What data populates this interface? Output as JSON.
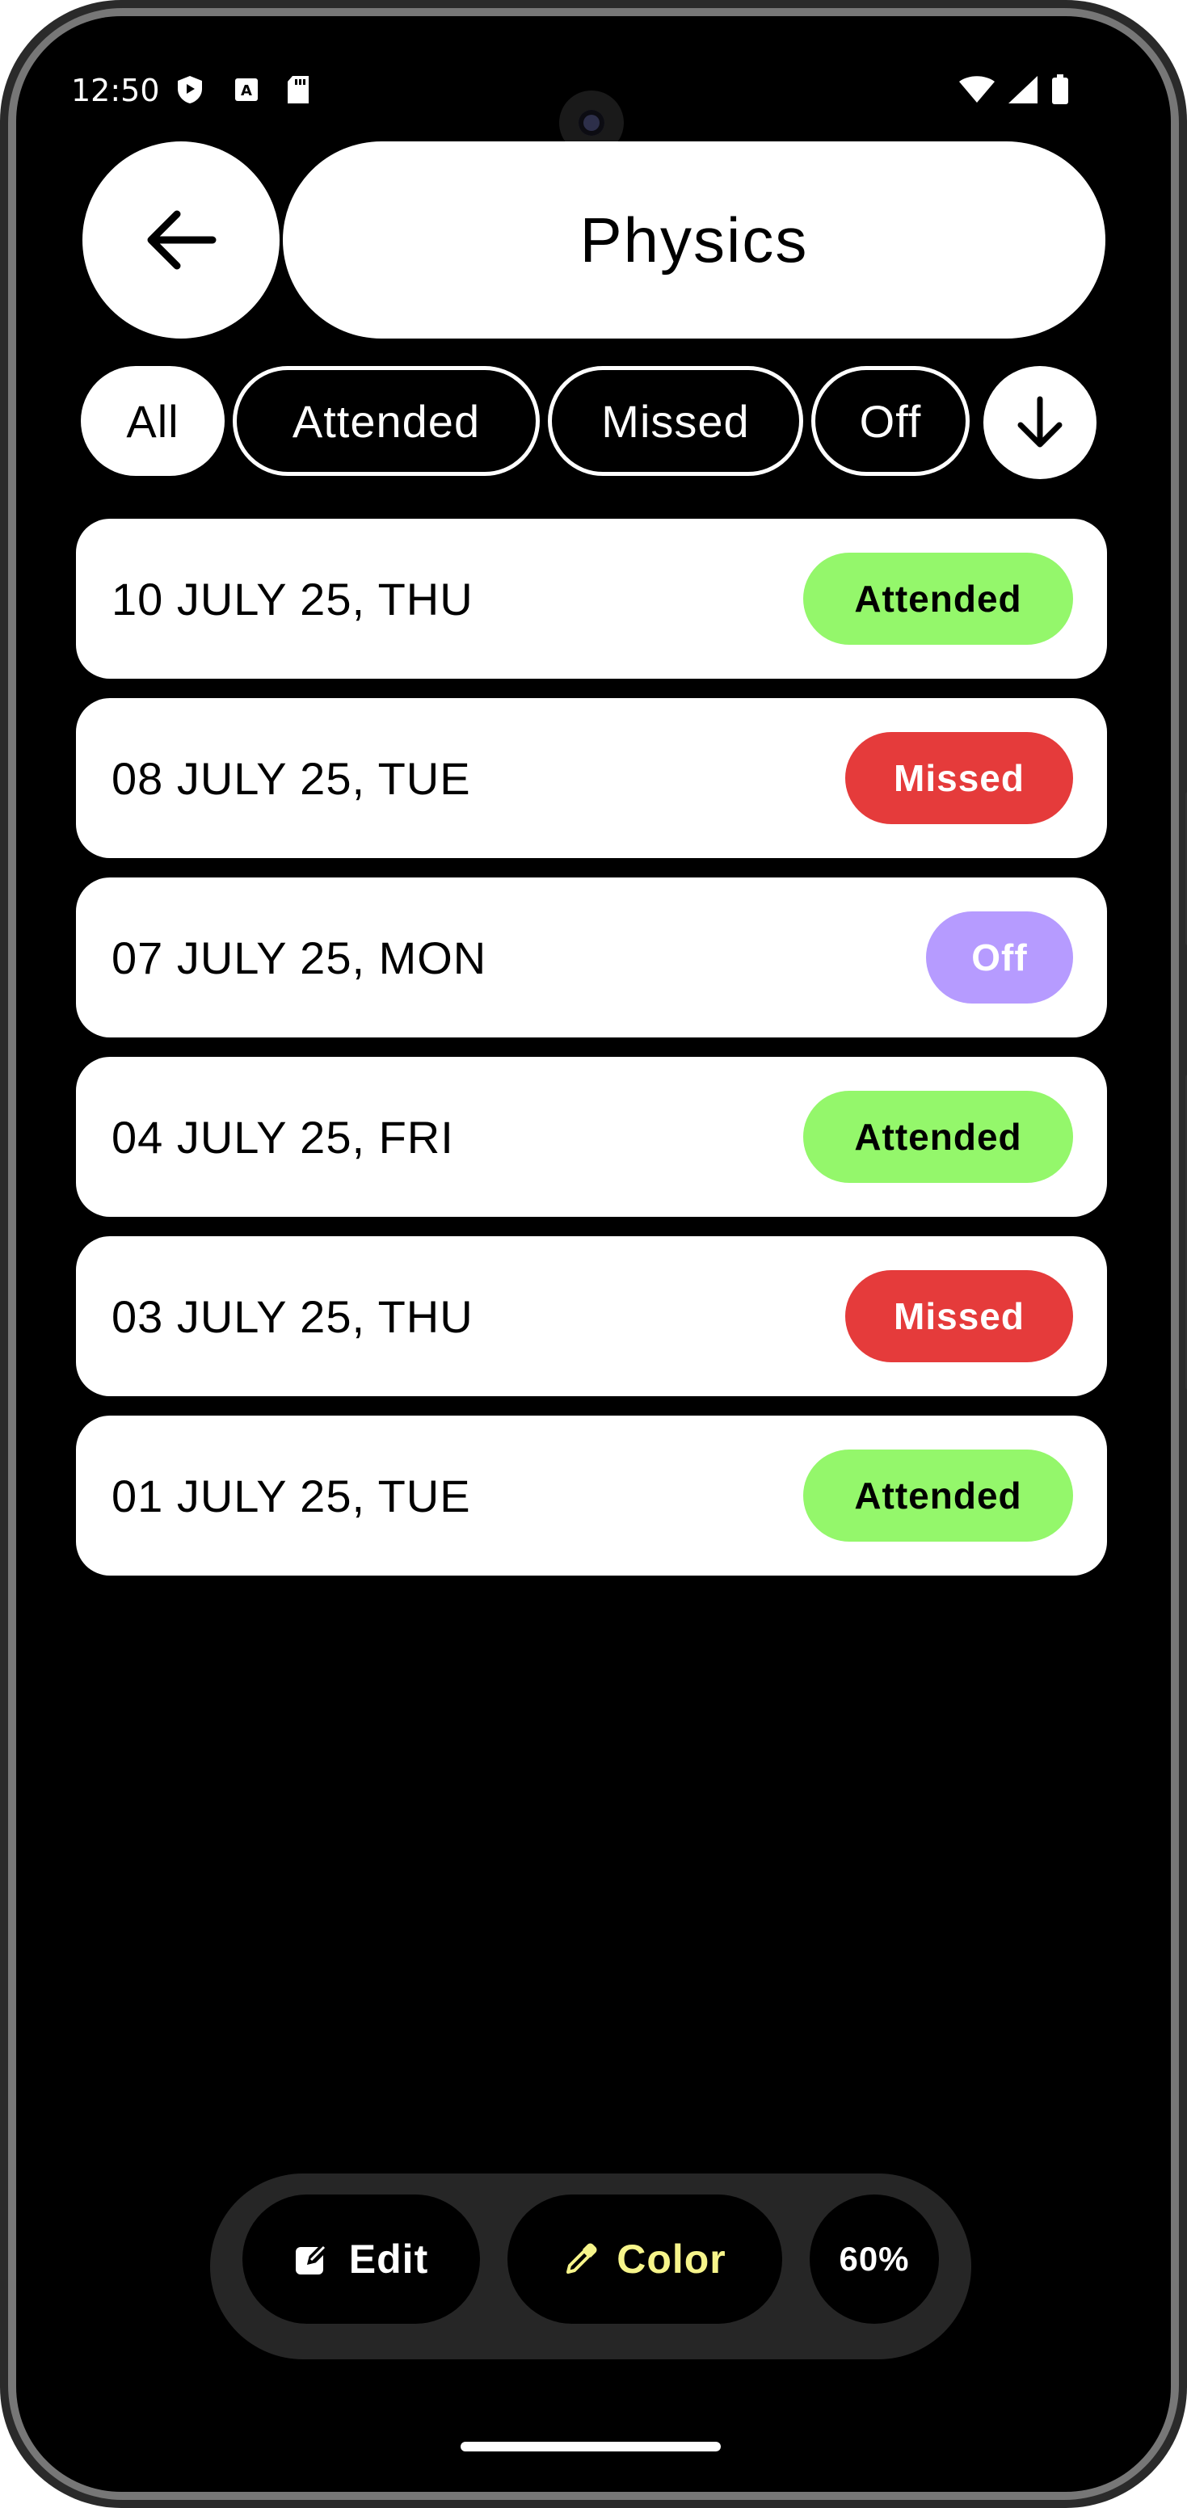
{
  "status_bar": {
    "time": "12:50",
    "left_icons": [
      "shield-icon",
      "font-a-icon",
      "sd-card-icon"
    ],
    "right_icons": [
      "wifi-icon",
      "signal-icon",
      "battery-icon"
    ]
  },
  "header": {
    "back_icon": "arrow-left-icon",
    "title": "Physics"
  },
  "filters": {
    "all": "All",
    "attended": "Attended",
    "missed": "Missed",
    "off": "Off",
    "selected": "All",
    "sort_icon": "arrow-down-icon"
  },
  "records": [
    {
      "date": "10 JULY 25, THU",
      "status": "Attended"
    },
    {
      "date": "08 JULY 25, TUE",
      "status": "Missed"
    },
    {
      "date": "07 JULY 25, MON",
      "status": "Off"
    },
    {
      "date": "04 JULY 25, FRI",
      "status": "Attended"
    },
    {
      "date": "03 JULY 25, THU",
      "status": "Missed"
    },
    {
      "date": "01 JULY 25, TUE",
      "status": "Attended"
    }
  ],
  "status_colors": {
    "Attended": {
      "bg": "#94f76b",
      "fg": "#000000"
    },
    "Missed": {
      "bg": "#e53b3b",
      "fg": "#ffffff"
    },
    "Off": {
      "bg": "#b69bff",
      "fg": "#ffffff"
    }
  },
  "toolbar": {
    "edit_label": "Edit",
    "edit_icon": "edit-icon",
    "color_label": "Color",
    "color_icon": "eyedropper-icon",
    "color_accent": "#f6f48a",
    "percent": "60%"
  }
}
